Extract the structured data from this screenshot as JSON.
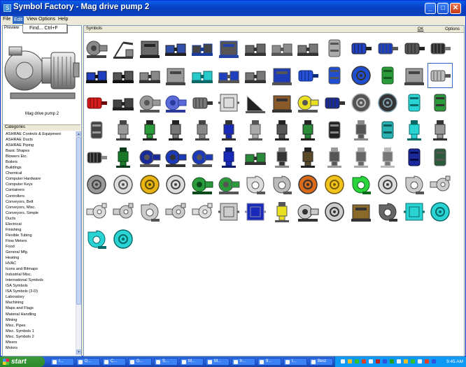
{
  "window": {
    "title": "Symbol Factory - Mag drive pump 2"
  },
  "menu": [
    {
      "label": "File"
    },
    {
      "label": "Edit",
      "active": true
    },
    {
      "label": "View"
    },
    {
      "label": "Options"
    },
    {
      "label": "Help"
    }
  ],
  "edit_menu": {
    "find_label": "Find...   Ctrl+F"
  },
  "preview": {
    "label": "Preview",
    "caption": "Mag drive pump 2"
  },
  "categories": {
    "label": "Categories",
    "items": [
      "ASHRAE Controls & Equipment",
      "ASHRAE Ducts",
      "ASHRAE Piping",
      "Basic Shapes",
      "Blowers Etc.",
      "Boilers",
      "Buildings",
      "Chemical",
      "Computer Hardware",
      "Computer Keys",
      "Containers",
      "Controllers",
      "Conveyors, Belt",
      "Conveyors, Misc.",
      "Conveyors, Simple",
      "Ducts",
      "Electrical",
      "Finishing",
      "Flexible Tubing",
      "Flow Meters",
      "Food",
      "General Mfg.",
      "Heating",
      "HVAC",
      "Icons and Bitmaps",
      "Industrial Misc.",
      "International Symbols",
      "ISA Symbols",
      "ISA Symbols (3-D)",
      "Laboratory",
      "Machining",
      "Maps and Flags",
      "Material Handling",
      "Mining",
      "Misc. Pipes",
      "Misc. Symbols 1",
      "Misc. Symbols 2",
      "Mixers",
      "Motors"
    ]
  },
  "symbols": {
    "label": "Symbols",
    "ok_label": "OK",
    "options_label": "Options",
    "selected_index": 27,
    "items": [
      {
        "kind": "pump",
        "color": "#8a8a8a",
        "accent": "#444"
      },
      {
        "kind": "pumpjack",
        "color": "#8a8a8a",
        "accent": "#333"
      },
      {
        "kind": "block",
        "color": "#6a6a6a",
        "accent": "#222"
      },
      {
        "kind": "skid",
        "color": "#2f4fa8",
        "accent": "#222"
      },
      {
        "kind": "skid",
        "color": "#444",
        "accent": "#1c3c9c"
      },
      {
        "kind": "block",
        "color": "#555",
        "accent": "#2244aa"
      },
      {
        "kind": "skid",
        "color": "#666",
        "accent": "#333"
      },
      {
        "kind": "skid",
        "color": "#8c8c8c",
        "accent": "#555"
      },
      {
        "kind": "skid",
        "color": "#777",
        "accent": "#333"
      },
      {
        "kind": "tank",
        "color": "#aaa",
        "accent": "#555"
      },
      {
        "kind": "motor",
        "color": "#1f43c8",
        "accent": "#222"
      },
      {
        "kind": "motor",
        "color": "#1a3dbf",
        "accent": "#555"
      },
      {
        "kind": "motor",
        "color": "#555",
        "accent": "#222"
      },
      {
        "kind": "motor",
        "color": "#2a2a2a",
        "accent": "#777"
      },
      {
        "kind": "skid",
        "color": "#1f3fbf",
        "accent": "#111"
      },
      {
        "kind": "skid",
        "color": "#555",
        "accent": "#111"
      },
      {
        "kind": "skid",
        "color": "#888",
        "accent": "#333"
      },
      {
        "kind": "block",
        "color": "#999",
        "accent": "#444"
      },
      {
        "kind": "skid",
        "color": "#27c9c9",
        "accent": "#0a6a6a"
      },
      {
        "kind": "skid",
        "color": "#1f3fbf",
        "accent": "#555"
      },
      {
        "kind": "skid",
        "color": "#777",
        "accent": "#333"
      },
      {
        "kind": "block",
        "color": "#1d3cb5",
        "accent": "#555"
      },
      {
        "kind": "motor",
        "color": "#2850d8",
        "accent": "#0a2a7a"
      },
      {
        "kind": "tank",
        "color": "#1f4fd0",
        "accent": "#555"
      },
      {
        "kind": "disc",
        "color": "#1f4fd0",
        "accent": "#333"
      },
      {
        "kind": "tank",
        "color": "#2b9a3a",
        "accent": "#145a1f"
      },
      {
        "kind": "block",
        "color": "#9a9a9a",
        "accent": "#444"
      },
      {
        "kind": "motor",
        "color": "#bbb",
        "accent": "#555"
      },
      {
        "kind": "motor",
        "color": "#d81c1c",
        "accent": "#6a0a0a"
      },
      {
        "kind": "skid",
        "color": "#444",
        "accent": "#222"
      },
      {
        "kind": "pump",
        "color": "#999",
        "accent": "#555"
      },
      {
        "kind": "pump",
        "color": "#5a6ad8",
        "accent": "#2a3a9a"
      },
      {
        "kind": "motor",
        "color": "#777",
        "accent": "#333"
      },
      {
        "kind": "box",
        "color": "#ddd",
        "accent": "#555"
      },
      {
        "kind": "wedge",
        "color": "#222",
        "accent": "#ddd"
      },
      {
        "kind": "block",
        "color": "#8a5a2a",
        "accent": "#333"
      },
      {
        "kind": "pump",
        "color": "#e8e020",
        "accent": "#555"
      },
      {
        "kind": "motor",
        "color": "#1a2a9a",
        "accent": "#333"
      },
      {
        "kind": "disc",
        "color": "#555",
        "accent": "#bbb"
      },
      {
        "kind": "disc",
        "color": "#333",
        "accent": "#7a9aa8"
      },
      {
        "kind": "tank",
        "color": "#2ad4d4",
        "accent": "#0a6a6a"
      },
      {
        "kind": "tank",
        "color": "#2a9a3a",
        "accent": "#333"
      },
      {
        "kind": "tank",
        "color": "#444",
        "accent": "#999"
      },
      {
        "kind": "tall",
        "color": "#999",
        "accent": "#444"
      },
      {
        "kind": "tall",
        "color": "#2a9a3a",
        "accent": "#222"
      },
      {
        "kind": "tall",
        "color": "#777",
        "accent": "#222"
      },
      {
        "kind": "tall",
        "color": "#888",
        "accent": "#444"
      },
      {
        "kind": "tall",
        "color": "#1a2ab8",
        "accent": "#333"
      },
      {
        "kind": "tall",
        "color": "#aaa",
        "accent": "#555"
      },
      {
        "kind": "tall",
        "color": "#555",
        "accent": "#222"
      },
      {
        "kind": "tall",
        "color": "#2a8a3a",
        "accent": "#222"
      },
      {
        "kind": "tank",
        "color": "#222",
        "accent": "#888"
      },
      {
        "kind": "tall",
        "color": "#555",
        "accent": "#888"
      },
      {
        "kind": "tank",
        "color": "#2ab0b0",
        "accent": "#0a5a5a"
      },
      {
        "kind": "tall",
        "color": "#2ad4d4",
        "accent": "#0a6a6a"
      },
      {
        "kind": "tall",
        "color": "#999",
        "accent": "#333"
      },
      {
        "kind": "motor",
        "color": "#222",
        "accent": "#888"
      },
      {
        "kind": "tall",
        "color": "#1a7a2a",
        "accent": "#0a3a1a"
      },
      {
        "kind": "pump",
        "color": "#1a2a9a",
        "accent": "#555"
      },
      {
        "kind": "pump",
        "color": "#1a3ab8",
        "accent": "#333"
      },
      {
        "kind": "pump",
        "color": "#1a3ab8",
        "accent": "#555"
      },
      {
        "kind": "tall",
        "color": "#1a2ab8",
        "accent": "#0a1a6a"
      },
      {
        "kind": "skid",
        "color": "#2a8a3a",
        "accent": "#333"
      },
      {
        "kind": "tall",
        "color": "#333",
        "accent": "#888"
      },
      {
        "kind": "tall",
        "color": "#5a4a2a",
        "accent": "#222"
      },
      {
        "kind": "tall",
        "color": "#555",
        "accent": "#999"
      },
      {
        "kind": "tall",
        "color": "#666",
        "accent": "#aaa"
      },
      {
        "kind": "tall",
        "color": "#777",
        "accent": "#bbb"
      },
      {
        "kind": "tank",
        "color": "#1a2a9a",
        "accent": "#0a0a4a"
      },
      {
        "kind": "tank",
        "color": "#2a5a3a",
        "accent": "#555"
      },
      {
        "kind": "disc",
        "color": "#999",
        "accent": "#444"
      },
      {
        "kind": "disc",
        "color": "#ddd",
        "accent": "#555"
      },
      {
        "kind": "disc",
        "color": "#e8b414",
        "accent": "#5a4a0a"
      },
      {
        "kind": "disc",
        "color": "#ddd",
        "accent": "#444"
      },
      {
        "kind": "pump",
        "color": "#2a9a3a",
        "accent": "#0a4a1a"
      },
      {
        "kind": "pump",
        "color": "#2a9a3a",
        "accent": "#555"
      },
      {
        "kind": "volute",
        "color": "#ddd",
        "accent": "#555"
      },
      {
        "kind": "volute",
        "color": "#bbb",
        "accent": "#555"
      },
      {
        "kind": "disc",
        "color": "#d86a1a",
        "accent": "#333"
      },
      {
        "kind": "disc",
        "color": "#f0c41a",
        "accent": "#7a5a0a"
      },
      {
        "kind": "volute",
        "color": "#2ad43a",
        "accent": "#0a6a1a"
      },
      {
        "kind": "disc",
        "color": "#ddd",
        "accent": "#444"
      },
      {
        "kind": "volute",
        "color": "#ccc",
        "accent": "#555"
      },
      {
        "kind": "pipe",
        "color": "#ccc",
        "accent": "#555"
      },
      {
        "kind": "pipe",
        "color": "#ddd",
        "accent": "#555"
      },
      {
        "kind": "pipe",
        "color": "#ccc",
        "accent": "#555"
      },
      {
        "kind": "volute",
        "color": "#ccc",
        "accent": "#555"
      },
      {
        "kind": "pipe",
        "color": "#ccc",
        "accent": "#555"
      },
      {
        "kind": "pipe",
        "color": "#ddd",
        "accent": "#555"
      },
      {
        "kind": "box",
        "color": "#ccc",
        "accent": "#555"
      },
      {
        "kind": "box",
        "color": "#1a2ab8",
        "accent": "#88a"
      },
      {
        "kind": "tall",
        "color": "#e8e020",
        "accent": "#555"
      },
      {
        "kind": "pump",
        "color": "#ccc",
        "accent": "#333"
      },
      {
        "kind": "disc",
        "color": "#ccc",
        "accent": "#333"
      },
      {
        "kind": "block",
        "color": "#8a6a2a",
        "accent": "#333"
      },
      {
        "kind": "volute",
        "color": "#666",
        "accent": "#333"
      },
      {
        "kind": "box",
        "color": "#2ad4d4",
        "accent": "#0a6a6a"
      },
      {
        "kind": "disc",
        "color": "#2ad4d4",
        "accent": "#0a6a6a"
      },
      {
        "kind": "volute",
        "color": "#2ad4d4",
        "accent": "#0a6a6a"
      },
      {
        "kind": "disc",
        "color": "#2ad4d4",
        "accent": "#0a6a6a"
      }
    ]
  },
  "taskbar": {
    "start_label": "start",
    "tasks": [
      "I...",
      "D...",
      "C...",
      "G...",
      "S...",
      "M...",
      "M...",
      "h...",
      "9...",
      "I...",
      "Best"
    ],
    "clock": "9:45 AM"
  },
  "colors": {
    "title_bar": "#0a46d0",
    "selection": "#316ac5",
    "taskbar": "#245edb"
  }
}
